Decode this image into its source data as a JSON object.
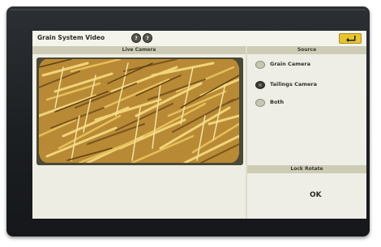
{
  "app": {
    "title": "Grain System Video",
    "help_buttons": [
      "?",
      "?"
    ],
    "exit_icon": "exit-arrow-icon"
  },
  "camera_panel": {
    "header": "Live Camera"
  },
  "source_panel": {
    "header": "Source",
    "options": [
      {
        "label": "Grain Camera",
        "selected": false
      },
      {
        "label": "Tailings Camera",
        "selected": true
      },
      {
        "label": "Both",
        "selected": false
      }
    ]
  },
  "lock_panel": {
    "header": "Lock Rotate",
    "ok_label": "OK"
  },
  "colors": {
    "bezel": "#1f2225",
    "screen_bg": "#efeee6",
    "header_band": "#cfccb5",
    "accent_yellow": "#e7c531",
    "camera_frame": "#4b4a36"
  }
}
